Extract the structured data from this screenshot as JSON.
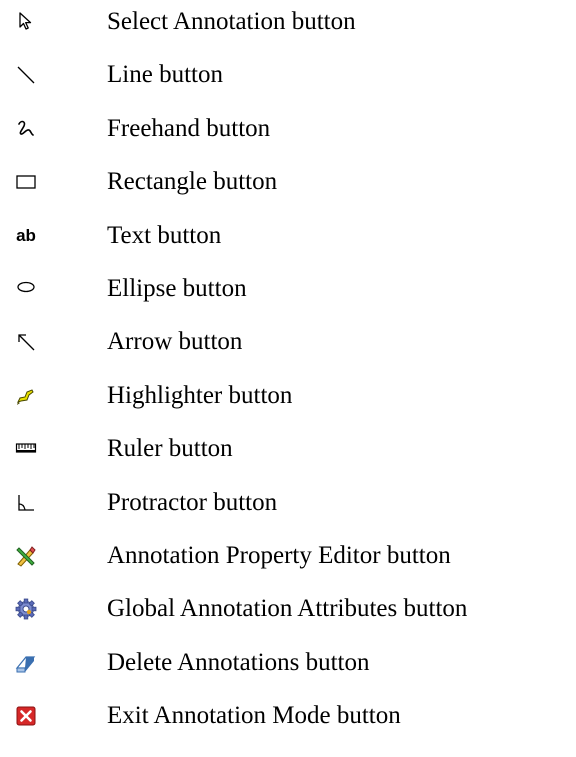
{
  "items": [
    {
      "label": "Select Annotation button",
      "icon": "select-arrow-icon"
    },
    {
      "label": "Line button",
      "icon": "line-icon"
    },
    {
      "label": "Freehand button",
      "icon": "freehand-icon"
    },
    {
      "label": "Rectangle button",
      "icon": "rectangle-icon"
    },
    {
      "label": "Text button",
      "icon": "text-icon",
      "glyph": "ab"
    },
    {
      "label": "Ellipse button",
      "icon": "ellipse-icon"
    },
    {
      "label": "Arrow button",
      "icon": "arrow-icon"
    },
    {
      "label": "Highlighter button",
      "icon": "highlighter-icon"
    },
    {
      "label": "Ruler button",
      "icon": "ruler-icon"
    },
    {
      "label": "Protractor button",
      "icon": "protractor-icon"
    },
    {
      "label": "Annotation Property Editor button",
      "icon": "property-editor-icon"
    },
    {
      "label": "Global Annotation Attributes button",
      "icon": "global-attributes-gear-icon"
    },
    {
      "label": "Delete Annotations button",
      "icon": "eraser-icon"
    },
    {
      "label": "Exit Annotation Mode button",
      "icon": "exit-close-icon"
    }
  ],
  "colors": {
    "highlighter": "#e8e000",
    "exit": "#d62828",
    "eraser": "#3a6fb0",
    "gear": "#5a6ab8"
  }
}
